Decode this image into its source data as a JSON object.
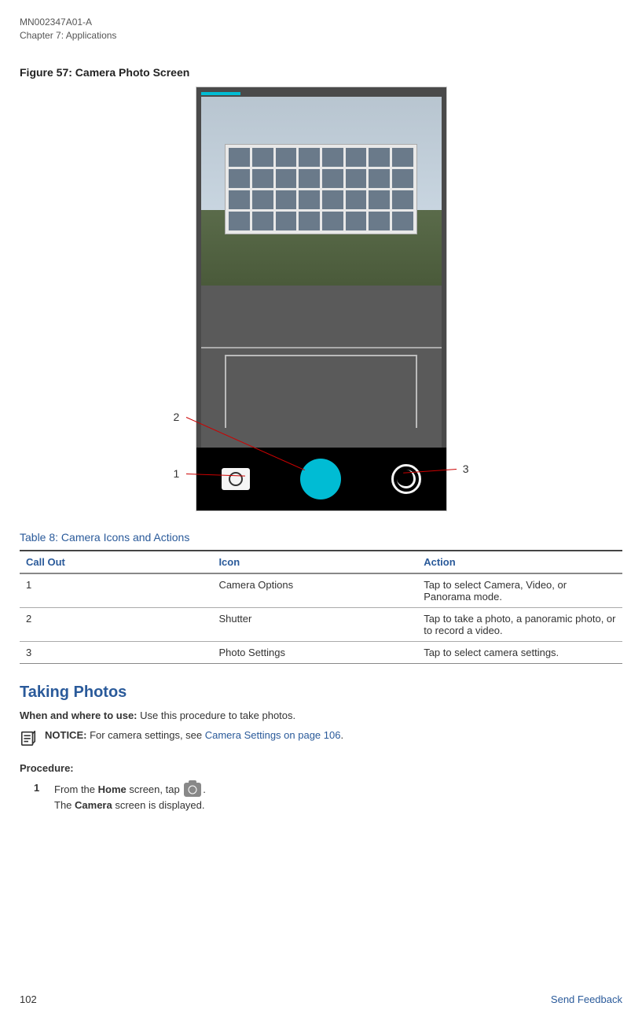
{
  "header": {
    "doc_id": "MN002347A01-A",
    "chapter": "Chapter 7:  Applications"
  },
  "figure": {
    "title": "Figure 57: Camera Photo Screen",
    "callouts": {
      "c1": "1",
      "c2": "2",
      "c3": "3"
    }
  },
  "table": {
    "title": "Table 8: Camera Icons and Actions",
    "headers": {
      "col1": "Call Out",
      "col2": "Icon",
      "col3": "Action"
    },
    "rows": [
      {
        "callout": "1",
        "icon": "Camera Options",
        "action": "Tap to select Camera, Video, or Panorama mode."
      },
      {
        "callout": "2",
        "icon": "Shutter",
        "action": "Tap to take a photo, a panoramic photo, or to record a video."
      },
      {
        "callout": "3",
        "icon": "Photo Settings",
        "action": "Tap to select camera settings."
      }
    ]
  },
  "section": {
    "title": "Taking Photos",
    "when_where_label": "When and where to use:",
    "when_where_text": " Use this procedure to take photos.",
    "notice_label": "NOTICE:",
    "notice_text_pre": " For camera settings, see ",
    "notice_link": "Camera Settings on page 106",
    "notice_text_post": ".",
    "procedure_label": "Procedure:",
    "step1_num": "1",
    "step1_pre": "From the ",
    "step1_bold1": "Home",
    "step1_mid": " screen, tap ",
    "step1_post": ".",
    "step1_line2_pre": "The ",
    "step1_line2_bold": "Camera",
    "step1_line2_post": " screen is displayed."
  },
  "footer": {
    "page": "102",
    "feedback": "Send Feedback"
  }
}
